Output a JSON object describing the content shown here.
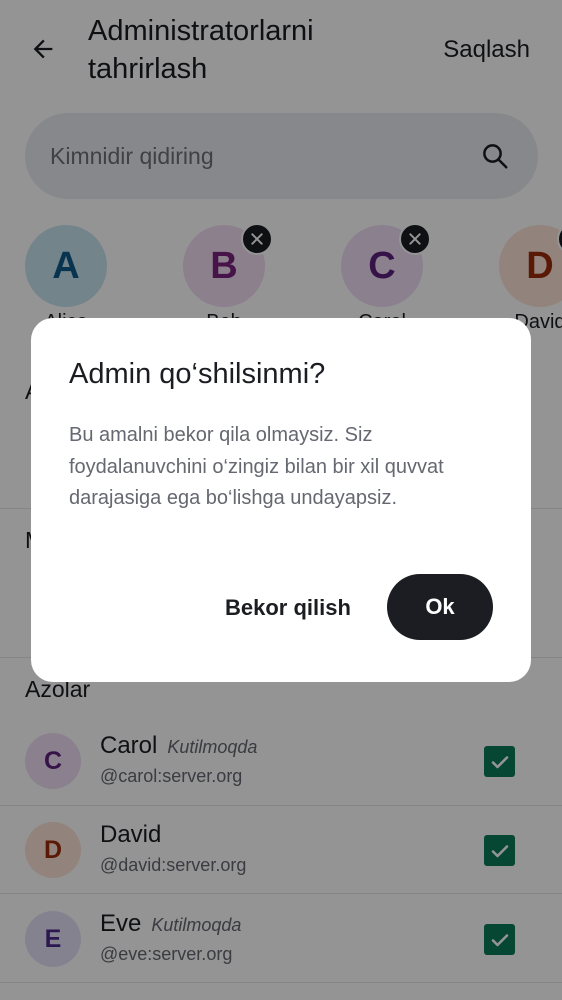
{
  "header": {
    "title": "Administratorlarni tahrirlash",
    "save_label": "Saqlash"
  },
  "search": {
    "placeholder": "Kimnidir qidiring"
  },
  "selected": [
    {
      "initial": "A",
      "name": "Alice",
      "removable": false,
      "bg": "#c8e4f0",
      "fg": "#0f5a8a"
    },
    {
      "initial": "B",
      "name": "Bob",
      "removable": true,
      "bg": "#f1dcf3",
      "fg": "#79237f"
    },
    {
      "initial": "C",
      "name": "Carol",
      "removable": true,
      "bg": "#efdcf5",
      "fg": "#5c1f7c"
    },
    {
      "initial": "D",
      "name": "David",
      "removable": true,
      "bg": "#fbe2d8",
      "fg": "#9a2b09"
    }
  ],
  "sections": {
    "admins_partial": "A",
    "moderators_partial": "M",
    "members": "Azolar"
  },
  "members": [
    {
      "initial": "C",
      "name": "Carol",
      "pending": "Kutilmoqda",
      "id": "@carol:server.org",
      "checked": true,
      "bg": "#efdcf5",
      "fg": "#5c1f7c"
    },
    {
      "initial": "D",
      "name": "David",
      "pending": "",
      "id": "@david:server.org",
      "checked": true,
      "bg": "#fbe2d8",
      "fg": "#9a2b09"
    },
    {
      "initial": "E",
      "name": "Eve",
      "pending": "Kutilmoqda",
      "id": "@eve:server.org",
      "checked": true,
      "bg": "#e6e0f8",
      "fg": "#4b2a8c"
    }
  ],
  "dialog": {
    "title": "Admin qo‘shilsinmi?",
    "body": "Bu amalni bekor qila olmaysiz. Siz foydalanuvchini o‘zingiz bilan bir xil quvvat darajasiga ega bo‘lishga undayapsiz.",
    "cancel_label": "Bekor qilish",
    "ok_label": "Ok"
  },
  "colors": {
    "accent_check": "#0b7a58",
    "primary_dark": "#1b1d22",
    "scrim": "rgba(0,0,0,0.42)"
  },
  "icons": {
    "back": "arrow-left-icon",
    "search": "search-icon",
    "remove": "close-icon",
    "check": "check-icon"
  }
}
